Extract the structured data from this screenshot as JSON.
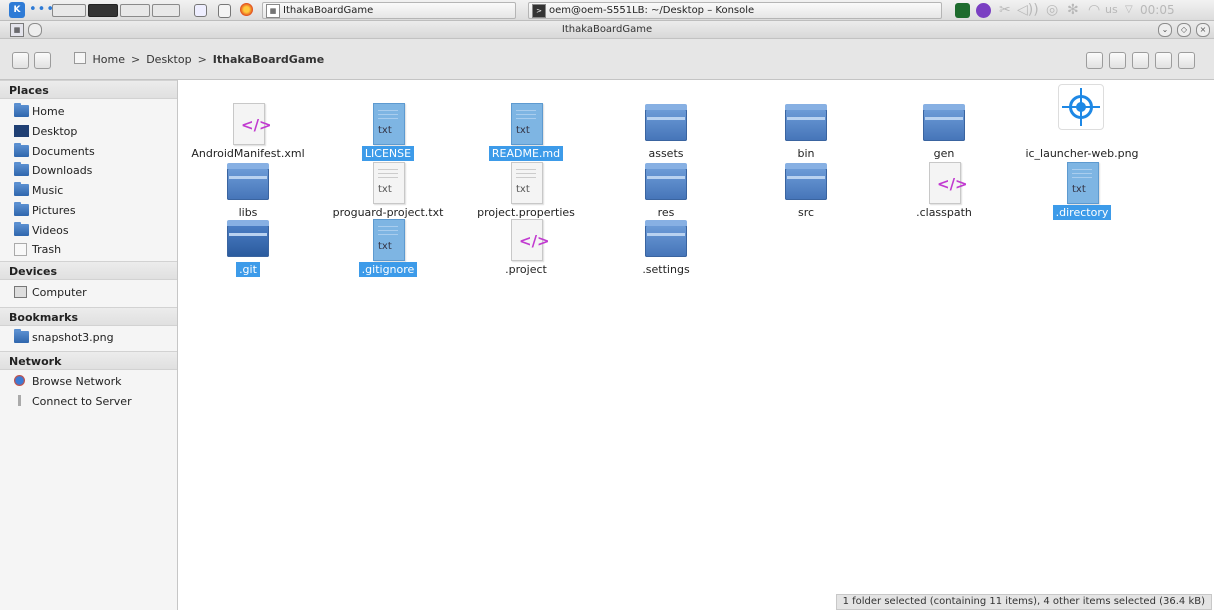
{
  "panel": {
    "kmenu_icon": "kde-menu-icon",
    "tasks": [
      {
        "label": "IthakaBoardGame"
      },
      {
        "label": "oem@oem-S551LB: ~/Desktop – Konsole"
      }
    ],
    "clock": "00:05",
    "keyboard_layout": "us"
  },
  "window": {
    "title": "IthakaBoardGame"
  },
  "breadcrumb": {
    "items": [
      "Home",
      "Desktop",
      "IthakaBoardGame"
    ],
    "separator": ">"
  },
  "sidebar": {
    "sections": [
      {
        "title": "Places",
        "items": [
          "Home",
          "Desktop",
          "Documents",
          "Downloads",
          "Music",
          "Pictures",
          "Videos",
          "Trash"
        ]
      },
      {
        "title": "Devices",
        "items": [
          "Computer"
        ]
      },
      {
        "title": "Bookmarks",
        "items": [
          "snapshot3.png"
        ]
      },
      {
        "title": "Network",
        "items": [
          "Browse Network",
          "Connect to Server"
        ]
      }
    ]
  },
  "files": [
    {
      "name": "AndroidManifest.xml",
      "kind": "xml",
      "selected": false
    },
    {
      "name": "LICENSE",
      "kind": "txt",
      "selected": true
    },
    {
      "name": "README.md",
      "kind": "txt",
      "selected": true
    },
    {
      "name": "assets",
      "kind": "folder",
      "selected": false
    },
    {
      "name": "bin",
      "kind": "folder",
      "selected": false
    },
    {
      "name": "gen",
      "kind": "folder",
      "selected": false
    },
    {
      "name": "ic_launcher-web.png",
      "kind": "image",
      "selected": false
    },
    {
      "name": "libs",
      "kind": "folder",
      "selected": false
    },
    {
      "name": "proguard-project.txt",
      "kind": "txt",
      "selected": false
    },
    {
      "name": "project.properties",
      "kind": "txt",
      "selected": false
    },
    {
      "name": "res",
      "kind": "folder",
      "selected": false
    },
    {
      "name": "src",
      "kind": "folder",
      "selected": false
    },
    {
      "name": ".classpath",
      "kind": "xml",
      "selected": false
    },
    {
      "name": ".directory",
      "kind": "txt",
      "selected": true
    },
    {
      "name": ".git",
      "kind": "folder",
      "selected": true
    },
    {
      "name": ".gitignore",
      "kind": "txt",
      "selected": true
    },
    {
      "name": ".project",
      "kind": "xml",
      "selected": false
    },
    {
      "name": ".settings",
      "kind": "folder",
      "selected": false
    }
  ],
  "icons": {
    "txt_label": "txt",
    "xml_label": "</>"
  },
  "status": "1 folder selected (containing 11 items), 4 other items selected (36.4 kB)"
}
